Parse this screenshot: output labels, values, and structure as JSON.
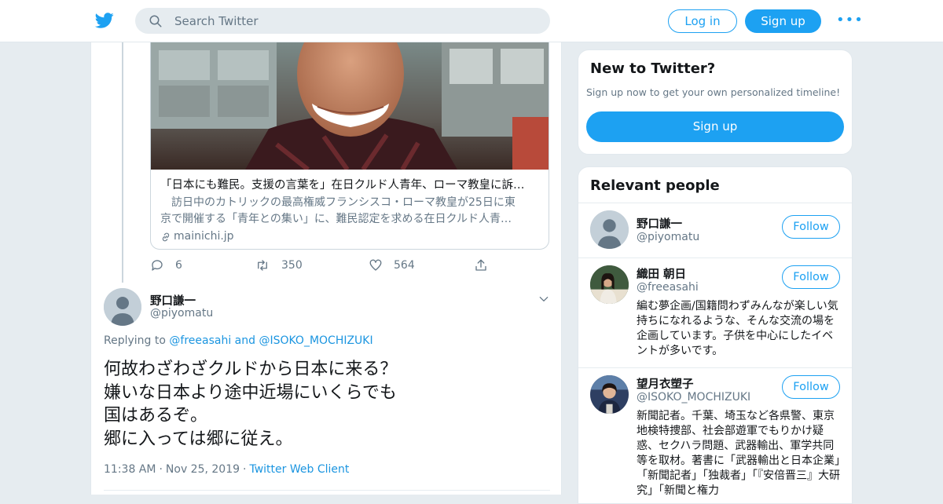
{
  "header": {
    "search_placeholder": "Search Twitter",
    "login_label": "Log in",
    "signup_label": "Sign up",
    "more_label": "•••"
  },
  "link_card": {
    "title": "「日本にも難民。支援の言葉を」在日クルド人青年、ローマ教皇に訴…",
    "description_line1": "　訪日中のカトリックの最高権威フランシスコ・ローマ教皇が25日に東",
    "description_line2": "京で開催する「青年との集い」に、難民認定を求める在日クルド人青…",
    "domain": "mainichi.jp"
  },
  "quoted_actions": {
    "replies": "6",
    "retweets": "350",
    "likes": "564"
  },
  "tweet": {
    "author_name": "野口謙一",
    "author_handle": "@piyomatu",
    "replying_prefix": "Replying to",
    "reply_to_1": "@freeasahi",
    "reply_joiner": "and",
    "reply_to_2": "@ISOKO_MOCHIZUKI",
    "body_lines": [
      "何故わざわざクルドから日本に来る？",
      "嫌いな日本より途中近場にいくらでも",
      "国はあるぞ。",
      "郷に入っては郷に従え。"
    ],
    "time": "11:38 AM",
    "date": "Nov 25, 2019",
    "source": "Twitter Web Client",
    "separator": "·"
  },
  "new_to_twitter": {
    "title": "New to Twitter?",
    "subtitle": "Sign up now to get your own personalized timeline!",
    "button_label": "Sign up"
  },
  "relevant_people": {
    "title": "Relevant people",
    "people": [
      {
        "name": "野口謙一",
        "handle": "@piyomatu",
        "follow_label": "Follow",
        "bio": ""
      },
      {
        "name": "織田 朝日",
        "handle": "@freeasahi",
        "follow_label": "Follow",
        "bio": "編む夢企画/国籍問わずみんなが楽しい気持ちになれるような、そんな交流の場を企画しています。子供を中心にしたイベントが多いです。"
      },
      {
        "name": "望月衣塑子",
        "handle": "@ISOKO_MOCHIZUKI",
        "follow_label": "Follow",
        "bio": "新聞記者。千葉、埼玉など各県警、東京地検特捜部、社会部遊軍でもりかけ疑惑、セクハラ問題、武器輸出、軍学共同等を取材。著書に「武器輸出と日本企業」「新聞記者」「独裁者」「『安倍晋三』大研究」「新聞と権力"
      }
    ]
  },
  "colors": {
    "accent": "#1da1f2",
    "link": "#1b95e0",
    "muted": "#657786",
    "background": "#e6ecf0"
  }
}
